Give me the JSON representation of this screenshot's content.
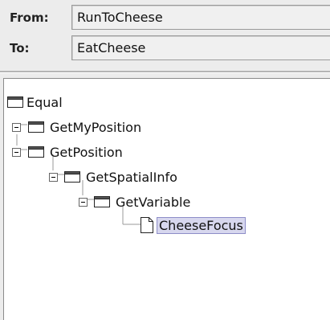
{
  "form": {
    "from_label": "From:",
    "from_value": "RunToCheese",
    "to_label": "To:",
    "to_value": "EatCheese"
  },
  "tree": {
    "nodes": [
      {
        "label": "Equal",
        "type": "folder",
        "expander": "none"
      },
      {
        "label": "GetMyPosition",
        "type": "folder",
        "expander": "minus"
      },
      {
        "label": "GetPosition",
        "type": "folder",
        "expander": "minus"
      },
      {
        "label": "GetSpatialInfo",
        "type": "folder",
        "expander": "minus"
      },
      {
        "label": "GetVariable",
        "type": "folder",
        "expander": "minus"
      },
      {
        "label": "CheeseFocus",
        "type": "file",
        "expander": "none",
        "selected": true
      }
    ]
  },
  "colors": {
    "selection_bg": "#d7d7ee",
    "selection_border": "#8e8ec8"
  }
}
